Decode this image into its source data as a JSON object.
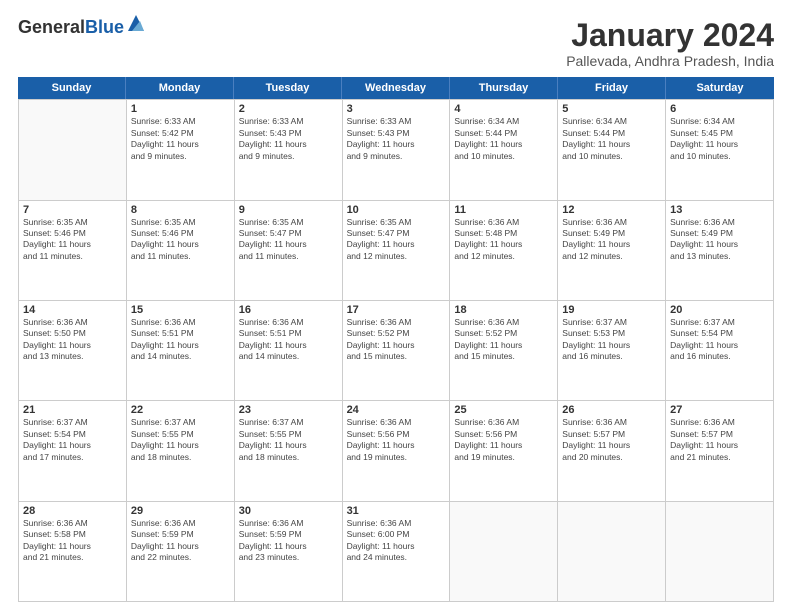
{
  "header": {
    "logo_general": "General",
    "logo_blue": "Blue",
    "month_title": "January 2024",
    "location": "Pallevada, Andhra Pradesh, India"
  },
  "weekdays": [
    "Sunday",
    "Monday",
    "Tuesday",
    "Wednesday",
    "Thursday",
    "Friday",
    "Saturday"
  ],
  "weeks": [
    [
      {
        "day": "",
        "info": ""
      },
      {
        "day": "1",
        "info": "Sunrise: 6:33 AM\nSunset: 5:42 PM\nDaylight: 11 hours\nand 9 minutes."
      },
      {
        "day": "2",
        "info": "Sunrise: 6:33 AM\nSunset: 5:43 PM\nDaylight: 11 hours\nand 9 minutes."
      },
      {
        "day": "3",
        "info": "Sunrise: 6:33 AM\nSunset: 5:43 PM\nDaylight: 11 hours\nand 9 minutes."
      },
      {
        "day": "4",
        "info": "Sunrise: 6:34 AM\nSunset: 5:44 PM\nDaylight: 11 hours\nand 10 minutes."
      },
      {
        "day": "5",
        "info": "Sunrise: 6:34 AM\nSunset: 5:44 PM\nDaylight: 11 hours\nand 10 minutes."
      },
      {
        "day": "6",
        "info": "Sunrise: 6:34 AM\nSunset: 5:45 PM\nDaylight: 11 hours\nand 10 minutes."
      }
    ],
    [
      {
        "day": "7",
        "info": "Sunrise: 6:35 AM\nSunset: 5:46 PM\nDaylight: 11 hours\nand 11 minutes."
      },
      {
        "day": "8",
        "info": "Sunrise: 6:35 AM\nSunset: 5:46 PM\nDaylight: 11 hours\nand 11 minutes."
      },
      {
        "day": "9",
        "info": "Sunrise: 6:35 AM\nSunset: 5:47 PM\nDaylight: 11 hours\nand 11 minutes."
      },
      {
        "day": "10",
        "info": "Sunrise: 6:35 AM\nSunset: 5:47 PM\nDaylight: 11 hours\nand 12 minutes."
      },
      {
        "day": "11",
        "info": "Sunrise: 6:36 AM\nSunset: 5:48 PM\nDaylight: 11 hours\nand 12 minutes."
      },
      {
        "day": "12",
        "info": "Sunrise: 6:36 AM\nSunset: 5:49 PM\nDaylight: 11 hours\nand 12 minutes."
      },
      {
        "day": "13",
        "info": "Sunrise: 6:36 AM\nSunset: 5:49 PM\nDaylight: 11 hours\nand 13 minutes."
      }
    ],
    [
      {
        "day": "14",
        "info": "Sunrise: 6:36 AM\nSunset: 5:50 PM\nDaylight: 11 hours\nand 13 minutes."
      },
      {
        "day": "15",
        "info": "Sunrise: 6:36 AM\nSunset: 5:51 PM\nDaylight: 11 hours\nand 14 minutes."
      },
      {
        "day": "16",
        "info": "Sunrise: 6:36 AM\nSunset: 5:51 PM\nDaylight: 11 hours\nand 14 minutes."
      },
      {
        "day": "17",
        "info": "Sunrise: 6:36 AM\nSunset: 5:52 PM\nDaylight: 11 hours\nand 15 minutes."
      },
      {
        "day": "18",
        "info": "Sunrise: 6:36 AM\nSunset: 5:52 PM\nDaylight: 11 hours\nand 15 minutes."
      },
      {
        "day": "19",
        "info": "Sunrise: 6:37 AM\nSunset: 5:53 PM\nDaylight: 11 hours\nand 16 minutes."
      },
      {
        "day": "20",
        "info": "Sunrise: 6:37 AM\nSunset: 5:54 PM\nDaylight: 11 hours\nand 16 minutes."
      }
    ],
    [
      {
        "day": "21",
        "info": "Sunrise: 6:37 AM\nSunset: 5:54 PM\nDaylight: 11 hours\nand 17 minutes."
      },
      {
        "day": "22",
        "info": "Sunrise: 6:37 AM\nSunset: 5:55 PM\nDaylight: 11 hours\nand 18 minutes."
      },
      {
        "day": "23",
        "info": "Sunrise: 6:37 AM\nSunset: 5:55 PM\nDaylight: 11 hours\nand 18 minutes."
      },
      {
        "day": "24",
        "info": "Sunrise: 6:36 AM\nSunset: 5:56 PM\nDaylight: 11 hours\nand 19 minutes."
      },
      {
        "day": "25",
        "info": "Sunrise: 6:36 AM\nSunset: 5:56 PM\nDaylight: 11 hours\nand 19 minutes."
      },
      {
        "day": "26",
        "info": "Sunrise: 6:36 AM\nSunset: 5:57 PM\nDaylight: 11 hours\nand 20 minutes."
      },
      {
        "day": "27",
        "info": "Sunrise: 6:36 AM\nSunset: 5:57 PM\nDaylight: 11 hours\nand 21 minutes."
      }
    ],
    [
      {
        "day": "28",
        "info": "Sunrise: 6:36 AM\nSunset: 5:58 PM\nDaylight: 11 hours\nand 21 minutes."
      },
      {
        "day": "29",
        "info": "Sunrise: 6:36 AM\nSunset: 5:59 PM\nDaylight: 11 hours\nand 22 minutes."
      },
      {
        "day": "30",
        "info": "Sunrise: 6:36 AM\nSunset: 5:59 PM\nDaylight: 11 hours\nand 23 minutes."
      },
      {
        "day": "31",
        "info": "Sunrise: 6:36 AM\nSunset: 6:00 PM\nDaylight: 11 hours\nand 24 minutes."
      },
      {
        "day": "",
        "info": ""
      },
      {
        "day": "",
        "info": ""
      },
      {
        "day": "",
        "info": ""
      }
    ]
  ]
}
